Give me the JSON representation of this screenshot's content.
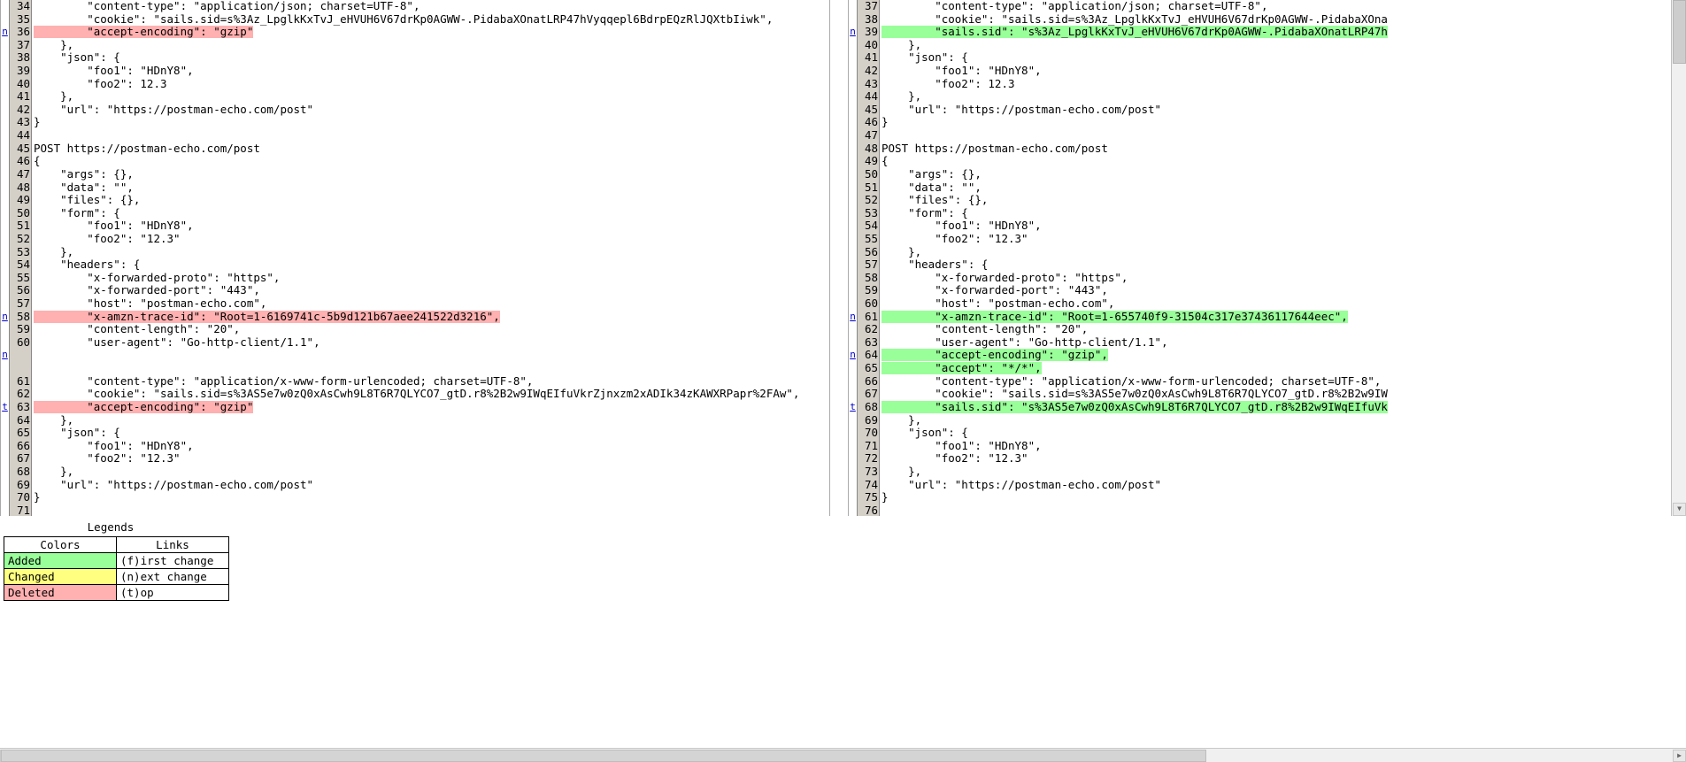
{
  "left_pane": {
    "name": "left-diff-pane",
    "lines": [
      {
        "n": 34,
        "link": "",
        "state": "same",
        "text": "        \"content-type\": \"application/json; charset=UTF-8\","
      },
      {
        "n": 35,
        "link": "",
        "state": "same",
        "text": "        \"cookie\": \"sails.sid=s%3Az_LpglkKxTvJ_eHVUH6V67drKp0AGWW-.PidabaXOnatLRP47hVyqqepl6BdrpEQzRlJQXtbIiwk\","
      },
      {
        "n": 36,
        "link": "n",
        "state": "del",
        "text": "        \"accept-encoding\": \"gzip\""
      },
      {
        "n": 37,
        "link": "",
        "state": "same",
        "text": "    },"
      },
      {
        "n": 38,
        "link": "",
        "state": "same",
        "text": "    \"json\": {"
      },
      {
        "n": 39,
        "link": "",
        "state": "same",
        "text": "        \"foo1\": \"HDnY8\","
      },
      {
        "n": 40,
        "link": "",
        "state": "same",
        "text": "        \"foo2\": 12.3"
      },
      {
        "n": 41,
        "link": "",
        "state": "same",
        "text": "    },"
      },
      {
        "n": 42,
        "link": "",
        "state": "same",
        "text": "    \"url\": \"https://postman-echo.com/post\""
      },
      {
        "n": 43,
        "link": "",
        "state": "same",
        "text": "}"
      },
      {
        "n": 44,
        "link": "",
        "state": "same",
        "text": ""
      },
      {
        "n": 45,
        "link": "",
        "state": "same",
        "text": "POST https://postman-echo.com/post"
      },
      {
        "n": 46,
        "link": "",
        "state": "same",
        "text": "{"
      },
      {
        "n": 47,
        "link": "",
        "state": "same",
        "text": "    \"args\": {},"
      },
      {
        "n": 48,
        "link": "",
        "state": "same",
        "text": "    \"data\": \"\","
      },
      {
        "n": 49,
        "link": "",
        "state": "same",
        "text": "    \"files\": {},"
      },
      {
        "n": 50,
        "link": "",
        "state": "same",
        "text": "    \"form\": {"
      },
      {
        "n": 51,
        "link": "",
        "state": "same",
        "text": "        \"foo1\": \"HDnY8\","
      },
      {
        "n": 52,
        "link": "",
        "state": "same",
        "text": "        \"foo2\": \"12.3\""
      },
      {
        "n": 53,
        "link": "",
        "state": "same",
        "text": "    },"
      },
      {
        "n": 54,
        "link": "",
        "state": "same",
        "text": "    \"headers\": {"
      },
      {
        "n": 55,
        "link": "",
        "state": "same",
        "text": "        \"x-forwarded-proto\": \"https\","
      },
      {
        "n": 56,
        "link": "",
        "state": "same",
        "text": "        \"x-forwarded-port\": \"443\","
      },
      {
        "n": 57,
        "link": "",
        "state": "same",
        "text": "        \"host\": \"postman-echo.com\","
      },
      {
        "n": 58,
        "link": "n",
        "state": "del",
        "text": "        \"x-amzn-trace-id\": \"Root=1-6169741c-5b9d121b67aee241522d3216\","
      },
      {
        "n": 59,
        "link": "",
        "state": "same",
        "text": "        \"content-length\": \"20\","
      },
      {
        "n": 60,
        "link": "",
        "state": "same",
        "text": "        \"user-agent\": \"Go-http-client/1.1\","
      },
      {
        "n": "",
        "link": "n",
        "state": "blank",
        "text": ""
      },
      {
        "n": "",
        "link": "",
        "state": "blank",
        "text": ""
      },
      {
        "n": 61,
        "link": "",
        "state": "same",
        "text": "        \"content-type\": \"application/x-www-form-urlencoded; charset=UTF-8\","
      },
      {
        "n": 62,
        "link": "",
        "state": "same",
        "text": "        \"cookie\": \"sails.sid=s%3AS5e7w0zQ0xAsCwh9L8T6R7QLYCO7_gtD.r8%2B2w9IWqEIfuVkrZjnxzm2xADIk34zKAWXRPapr%2FAw\","
      },
      {
        "n": 63,
        "link": "t",
        "state": "del",
        "text": "        \"accept-encoding\": \"gzip\""
      },
      {
        "n": 64,
        "link": "",
        "state": "same",
        "text": "    },"
      },
      {
        "n": 65,
        "link": "",
        "state": "same",
        "text": "    \"json\": {"
      },
      {
        "n": 66,
        "link": "",
        "state": "same",
        "text": "        \"foo1\": \"HDnY8\","
      },
      {
        "n": 67,
        "link": "",
        "state": "same",
        "text": "        \"foo2\": \"12.3\""
      },
      {
        "n": 68,
        "link": "",
        "state": "same",
        "text": "    },"
      },
      {
        "n": 69,
        "link": "",
        "state": "same",
        "text": "    \"url\": \"https://postman-echo.com/post\""
      },
      {
        "n": 70,
        "link": "",
        "state": "same",
        "text": "}"
      },
      {
        "n": 71,
        "link": "",
        "state": "same",
        "text": ""
      }
    ]
  },
  "right_pane": {
    "name": "right-diff-pane",
    "lines": [
      {
        "n": 37,
        "link": "",
        "state": "same",
        "text": "        \"content-type\": \"application/json; charset=UTF-8\","
      },
      {
        "n": 38,
        "link": "",
        "state": "same",
        "text": "        \"cookie\": \"sails.sid=s%3Az_LpglkKxTvJ_eHVUH6V67drKp0AGWW-.PidabaXOna"
      },
      {
        "n": 39,
        "link": "n",
        "state": "add",
        "text": "        \"sails.sid\": \"s%3Az_LpglkKxTvJ_eHVUH6V67drKp0AGWW-.PidabaXOnatLRP47h"
      },
      {
        "n": 40,
        "link": "",
        "state": "same",
        "text": "    },"
      },
      {
        "n": 41,
        "link": "",
        "state": "same",
        "text": "    \"json\": {"
      },
      {
        "n": 42,
        "link": "",
        "state": "same",
        "text": "        \"foo1\": \"HDnY8\","
      },
      {
        "n": 43,
        "link": "",
        "state": "same",
        "text": "        \"foo2\": 12.3"
      },
      {
        "n": 44,
        "link": "",
        "state": "same",
        "text": "    },"
      },
      {
        "n": 45,
        "link": "",
        "state": "same",
        "text": "    \"url\": \"https://postman-echo.com/post\""
      },
      {
        "n": 46,
        "link": "",
        "state": "same",
        "text": "}"
      },
      {
        "n": 47,
        "link": "",
        "state": "same",
        "text": ""
      },
      {
        "n": 48,
        "link": "",
        "state": "same",
        "text": "POST https://postman-echo.com/post"
      },
      {
        "n": 49,
        "link": "",
        "state": "same",
        "text": "{"
      },
      {
        "n": 50,
        "link": "",
        "state": "same",
        "text": "    \"args\": {},"
      },
      {
        "n": 51,
        "link": "",
        "state": "same",
        "text": "    \"data\": \"\","
      },
      {
        "n": 52,
        "link": "",
        "state": "same",
        "text": "    \"files\": {},"
      },
      {
        "n": 53,
        "link": "",
        "state": "same",
        "text": "    \"form\": {"
      },
      {
        "n": 54,
        "link": "",
        "state": "same",
        "text": "        \"foo1\": \"HDnY8\","
      },
      {
        "n": 55,
        "link": "",
        "state": "same",
        "text": "        \"foo2\": \"12.3\""
      },
      {
        "n": 56,
        "link": "",
        "state": "same",
        "text": "    },"
      },
      {
        "n": 57,
        "link": "",
        "state": "same",
        "text": "    \"headers\": {"
      },
      {
        "n": 58,
        "link": "",
        "state": "same",
        "text": "        \"x-forwarded-proto\": \"https\","
      },
      {
        "n": 59,
        "link": "",
        "state": "same",
        "text": "        \"x-forwarded-port\": \"443\","
      },
      {
        "n": 60,
        "link": "",
        "state": "same",
        "text": "        \"host\": \"postman-echo.com\","
      },
      {
        "n": 61,
        "link": "n",
        "state": "add",
        "text": "        \"x-amzn-trace-id\": \"Root=1-655740f9-31504c317e37436117644eec\","
      },
      {
        "n": 62,
        "link": "",
        "state": "same",
        "text": "        \"content-length\": \"20\","
      },
      {
        "n": 63,
        "link": "",
        "state": "same",
        "text": "        \"user-agent\": \"Go-http-client/1.1\","
      },
      {
        "n": 64,
        "link": "n",
        "state": "add",
        "text": "        \"accept-encoding\": \"gzip\","
      },
      {
        "n": 65,
        "link": "",
        "state": "add",
        "text": "        \"accept\": \"*/*\","
      },
      {
        "n": 66,
        "link": "",
        "state": "same",
        "text": "        \"content-type\": \"application/x-www-form-urlencoded; charset=UTF-8\","
      },
      {
        "n": 67,
        "link": "",
        "state": "same",
        "text": "        \"cookie\": \"sails.sid=s%3AS5e7w0zQ0xAsCwh9L8T6R7QLYCO7_gtD.r8%2B2w9IW"
      },
      {
        "n": 68,
        "link": "t",
        "state": "add",
        "text": "        \"sails.sid\": \"s%3AS5e7w0zQ0xAsCwh9L8T6R7QLYCO7_gtD.r8%2B2w9IWqEIfuVk"
      },
      {
        "n": 69,
        "link": "",
        "state": "same",
        "text": "    },"
      },
      {
        "n": 70,
        "link": "",
        "state": "same",
        "text": "    \"json\": {"
      },
      {
        "n": 71,
        "link": "",
        "state": "same",
        "text": "        \"foo1\": \"HDnY8\","
      },
      {
        "n": 72,
        "link": "",
        "state": "same",
        "text": "        \"foo2\": \"12.3\""
      },
      {
        "n": 73,
        "link": "",
        "state": "same",
        "text": "    },"
      },
      {
        "n": 74,
        "link": "",
        "state": "same",
        "text": "    \"url\": \"https://postman-echo.com/post\""
      },
      {
        "n": 75,
        "link": "",
        "state": "same",
        "text": "}"
      },
      {
        "n": 76,
        "link": "",
        "state": "same",
        "text": ""
      }
    ]
  },
  "legends": {
    "title": "Legends",
    "col_colors_header": "Colors",
    "col_links_header": "Links",
    "rows": [
      {
        "color_label": "Added",
        "color_hex": "#99ff99",
        "link_label": "(f)irst change"
      },
      {
        "color_label": "Changed",
        "color_hex": "#ffff80",
        "link_label": "(n)ext change"
      },
      {
        "color_label": "Deleted",
        "color_hex": "#ffb0b0",
        "link_label": "(t)op"
      }
    ]
  },
  "scrollbars": {
    "vertical_up": "▲",
    "vertical_down": "▼",
    "horizontal_left": "◀",
    "horizontal_right": "▶"
  }
}
